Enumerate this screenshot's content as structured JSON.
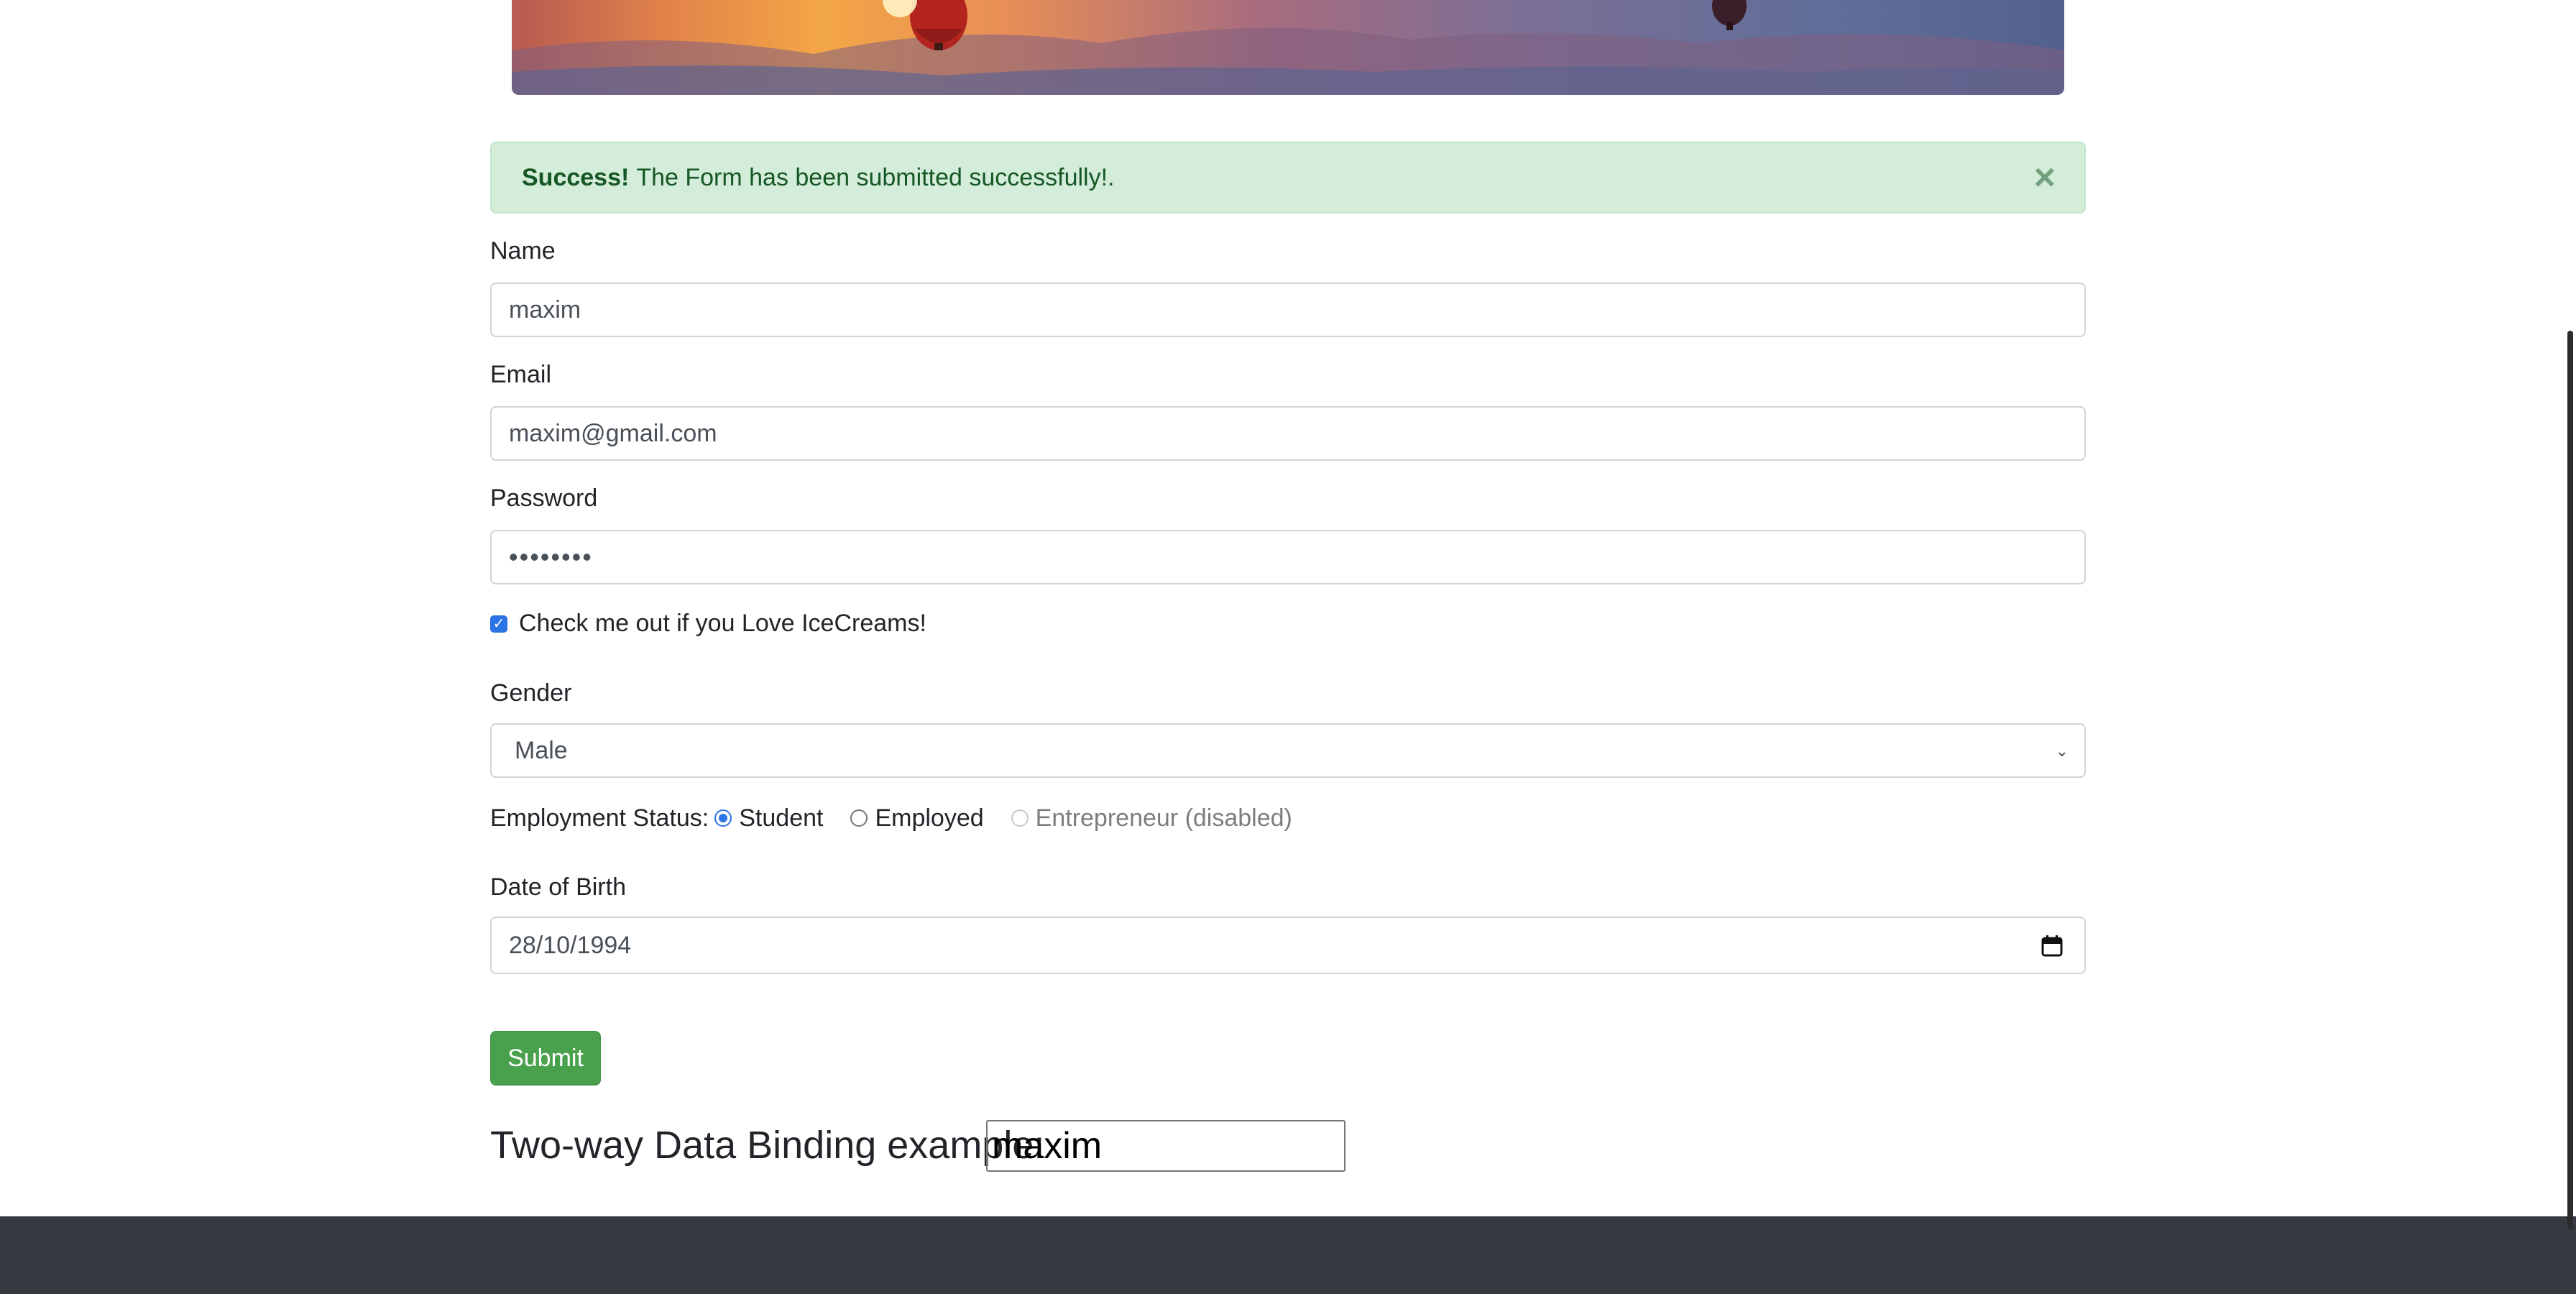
{
  "alert": {
    "strong": "Success!",
    "message": "The Form has been submitted successfully!.",
    "close": "×"
  },
  "fields": {
    "name": {
      "label": "Name",
      "value": "maxim"
    },
    "email": {
      "label": "Email",
      "value": "maxim@gmail.com"
    },
    "password": {
      "label": "Password",
      "value": "••••••••"
    }
  },
  "checkbox": {
    "label": "Check me out if you Love IceCreams!",
    "checked": true
  },
  "gender": {
    "label": "Gender",
    "selected": "Male"
  },
  "employment": {
    "label": "Employment Status:",
    "options": [
      {
        "label": "Student",
        "checked": true
      },
      {
        "label": "Employed",
        "checked": false
      },
      {
        "label": "Entrepreneur (disabled)",
        "disabled": true
      }
    ]
  },
  "dob": {
    "label": "Date of Birth",
    "value": "28/10/1994"
  },
  "submit": {
    "label": "Submit"
  },
  "binding": {
    "title": "Two-way Data Binding example:",
    "value": "maxim"
  },
  "colors": {
    "success_bg": "#d4edda",
    "success_text": "#155724",
    "button_green": "#4aa14d",
    "footer": "#343a40",
    "accent_blue": "#2b74e6"
  }
}
